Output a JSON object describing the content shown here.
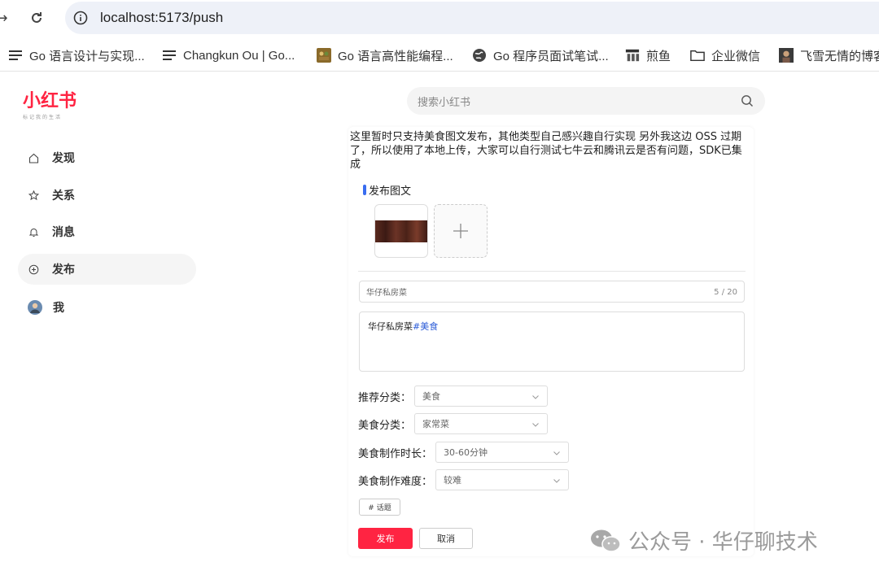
{
  "browser": {
    "url": "localhost:5173/push",
    "bookmarks": [
      {
        "label": "Go 语言设计与实现...",
        "icon": "lines-icon"
      },
      {
        "label": "Changkun Ou | Go...",
        "icon": "lines-icon"
      },
      {
        "label": "Go 语言高性能编程...",
        "icon": "gopher-icon"
      },
      {
        "label": "Go 程序员面试笔试...",
        "icon": "globe-icon"
      },
      {
        "label": "煎鱼",
        "icon": "fish-icon"
      },
      {
        "label": "企业微信",
        "icon": "folder-icon"
      },
      {
        "label": "飞雪无情的博客",
        "icon": "avatar-icon"
      }
    ]
  },
  "brand": {
    "name": "小红书",
    "slogan": "标记我的生活",
    "color": "#ff2442"
  },
  "search": {
    "placeholder": "搜索小红书"
  },
  "sidebar": {
    "items": [
      {
        "label": "发现",
        "icon": "home-icon"
      },
      {
        "label": "关系",
        "icon": "star-icon"
      },
      {
        "label": "消息",
        "icon": "bell-icon"
      },
      {
        "label": "发布",
        "icon": "plus-circle-icon"
      },
      {
        "label": "我",
        "icon": "avatar-icon"
      }
    ],
    "active": "发布"
  },
  "notice": "这里暂时只支持美食图文发布，其他类型自己感兴趣自行实现 另外我这边 OSS 过期了，所以使用了本地上传，大家可以自行测试七牛云和腾讯云是否有问题，SDK已集成",
  "form": {
    "section_title": "发布图文",
    "title_value": "华仔私房菜",
    "title_count": "5 / 20",
    "content_text": "华仔私房菜",
    "content_tag": "#美食",
    "fields": [
      {
        "label": "推荐分类：",
        "value": "美食"
      },
      {
        "label": "美食分类：",
        "value": "家常菜"
      },
      {
        "label": "美食制作时长：",
        "value": "30-60分钟"
      },
      {
        "label": "美食制作难度：",
        "value": "较难"
      }
    ],
    "topic_button": "# 话题",
    "submit_label": "发布",
    "cancel_label": "取消"
  },
  "watermark": "公众号 · 华仔聊技术"
}
